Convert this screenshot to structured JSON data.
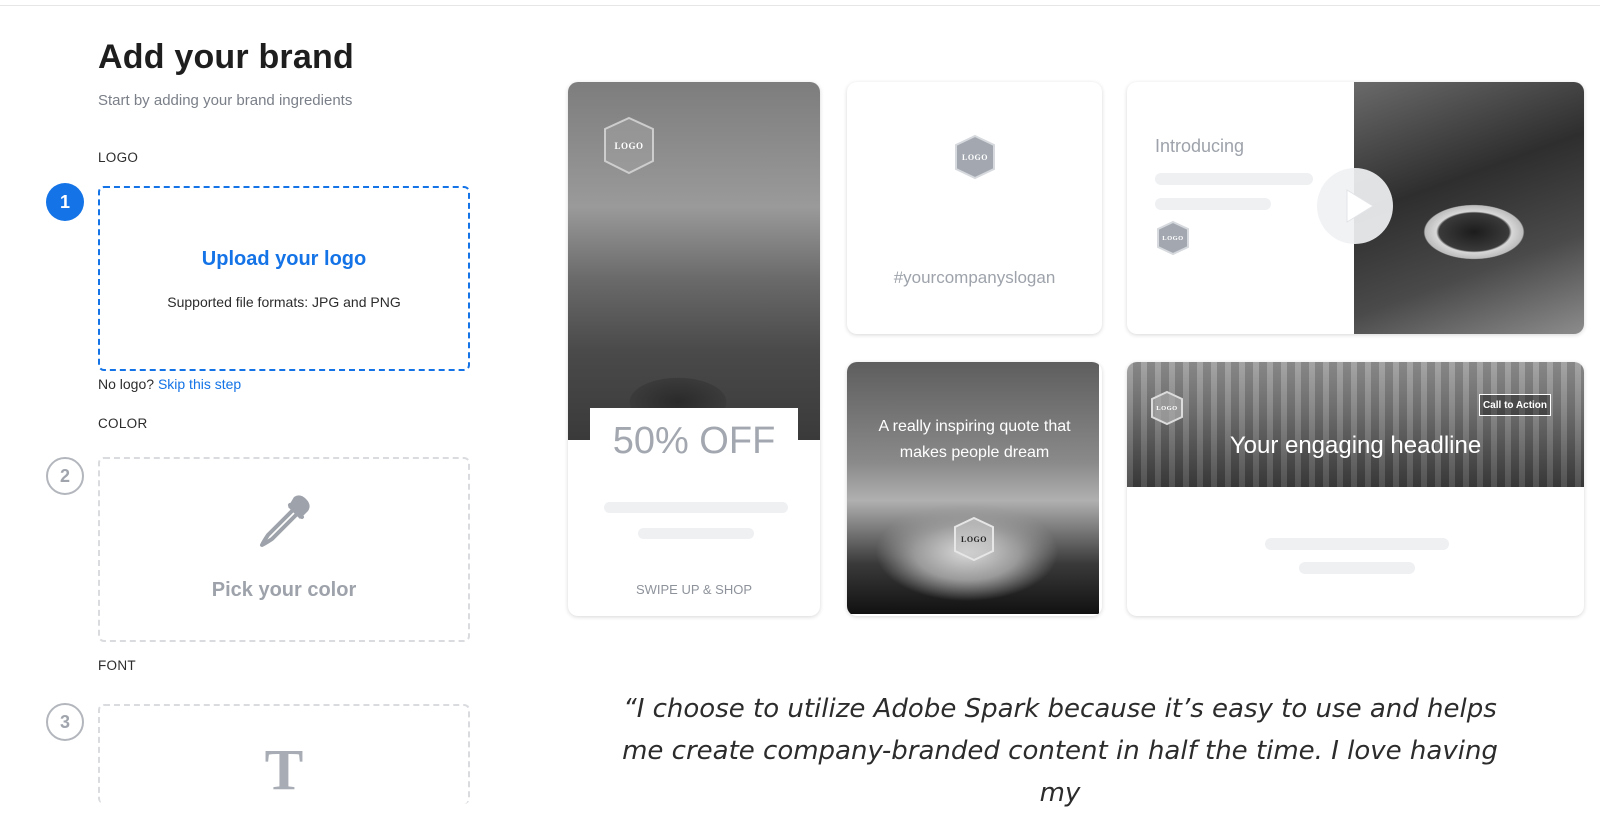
{
  "header": {
    "title": "Add your brand",
    "subtitle": "Start by adding your brand ingredients"
  },
  "steps": {
    "logo": {
      "number": "1",
      "label": "LOGO",
      "upload_title": "Upload your logo",
      "formats_note": "Supported file formats: JPG and PNG",
      "no_logo_text": "No logo?",
      "skip_link": "Skip this step"
    },
    "color": {
      "number": "2",
      "label": "COLOR",
      "pick_title": "Pick your color",
      "icon": "eyedropper-icon"
    },
    "font": {
      "number": "3",
      "label": "FONT",
      "icon": "T"
    }
  },
  "preview_cards": {
    "promo": {
      "logo": "LOGO",
      "headline": "50% OFF",
      "footer": "SWIPE UP & SHOP"
    },
    "slogan": {
      "logo": "LOGO",
      "text": "#yourcompanyslogan"
    },
    "video": {
      "label": "Introducing",
      "logo": "LOGO",
      "icon": "play-icon"
    },
    "quote": {
      "text": "A really inspiring quote that makes people dream",
      "logo": "LOGO"
    },
    "headline": {
      "logo": "LOGO",
      "cta": "Call to Action",
      "headline": "Your engaging headline"
    }
  },
  "testimonial": {
    "text": "“I choose to utilize Adobe Spark because it’s easy to use and helps me create company-branded content in half the time. I love having my"
  },
  "colors": {
    "accent": "#1473e6",
    "muted": "#9ea3ab",
    "placeholder": "#eef0f2"
  }
}
